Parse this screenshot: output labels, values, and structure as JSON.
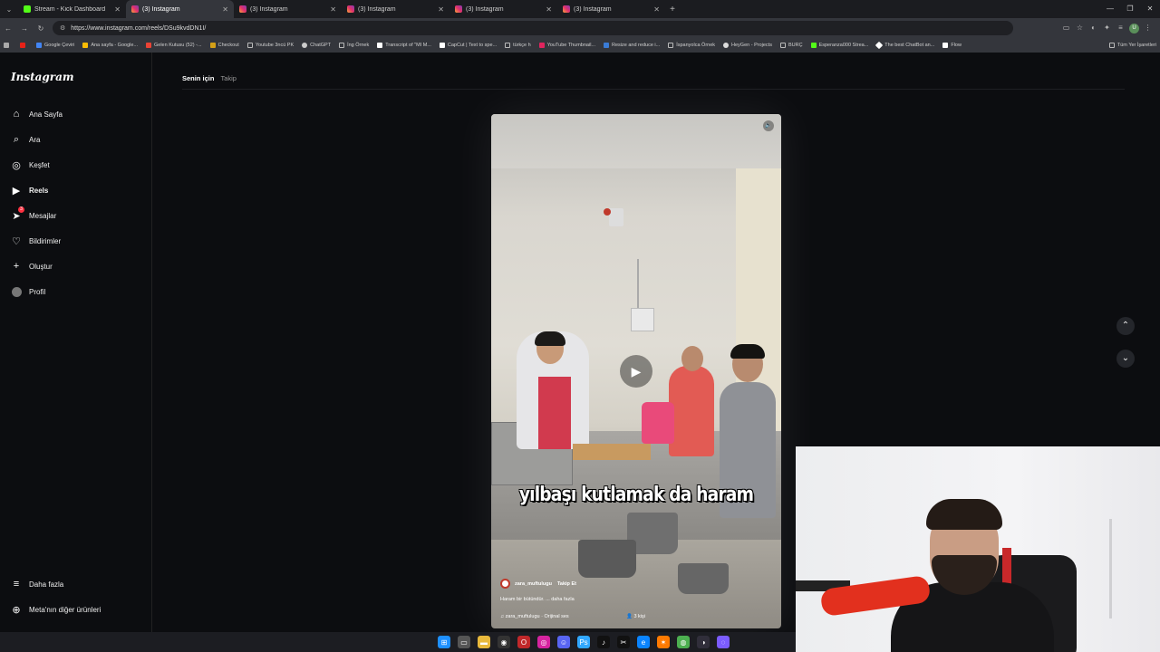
{
  "browser": {
    "tabs": [
      {
        "label": "Stream - Kick Dashboard",
        "favicon": "kick",
        "active": false
      },
      {
        "label": "(3) Instagram",
        "favicon": "instagram",
        "active": true
      },
      {
        "label": "(3) Instagram",
        "favicon": "instagram",
        "active": false
      },
      {
        "label": "(3) Instagram",
        "favicon": "instagram",
        "active": false
      },
      {
        "label": "(3) Instagram",
        "favicon": "instagram",
        "active": false
      },
      {
        "label": "(3) Instagram",
        "favicon": "instagram",
        "active": false
      }
    ],
    "url": "https://www.instagram.com/reels/DSu9kvdDN1I/",
    "profile_initial": "U",
    "bookmarks": [
      "Google Çeviri",
      "Ana sayfa - Google...",
      "Gelen Kutusu (52) -...",
      "Checkout",
      "Youtube 3ncü PK",
      "ChatGPT",
      "İng Örnek",
      "Transcript of \"MI M...",
      "CapCut | Text to spe...",
      "türkçe h",
      "YouTube Thumbnail...",
      "Resize and reduce i...",
      "İspanyolca Örnek",
      "HeyGen - Projects",
      "BURÇ",
      "Esperanza000 Strea...",
      "The best ChatBot an...",
      "Flow"
    ],
    "bookmarks_all": "Tüm Yer İşaretleri"
  },
  "sidebar": {
    "logo": "Instagram",
    "items": [
      {
        "label": "Ana Sayfa",
        "icon": "home-icon"
      },
      {
        "label": "Ara",
        "icon": "search-icon"
      },
      {
        "label": "Keşfet",
        "icon": "compass-icon"
      },
      {
        "label": "Reels",
        "icon": "reels-icon"
      },
      {
        "label": "Mesajlar",
        "icon": "messenger-icon",
        "badge": "3"
      },
      {
        "label": "Bildirimler",
        "icon": "heart-icon"
      },
      {
        "label": "Oluştur",
        "icon": "plus-icon"
      },
      {
        "label": "Profil",
        "icon": "avatar"
      }
    ],
    "more": "Daha fazla",
    "meta": "Meta'nın diğer ürünleri"
  },
  "feed": {
    "tabs": [
      "Senin için",
      "Takip"
    ]
  },
  "reel": {
    "caption": "yılbaşı kutlamak da haram",
    "username": "zara_muftulugu",
    "follow": "Takip Et",
    "description": "Haram bir bütündür. ... daha fazla",
    "audio": "zara_muftulugu · Orijinal ses",
    "people": "3 kişi"
  },
  "colors": {
    "accent_badge": "#ff3040",
    "background": "#0c0d10"
  }
}
